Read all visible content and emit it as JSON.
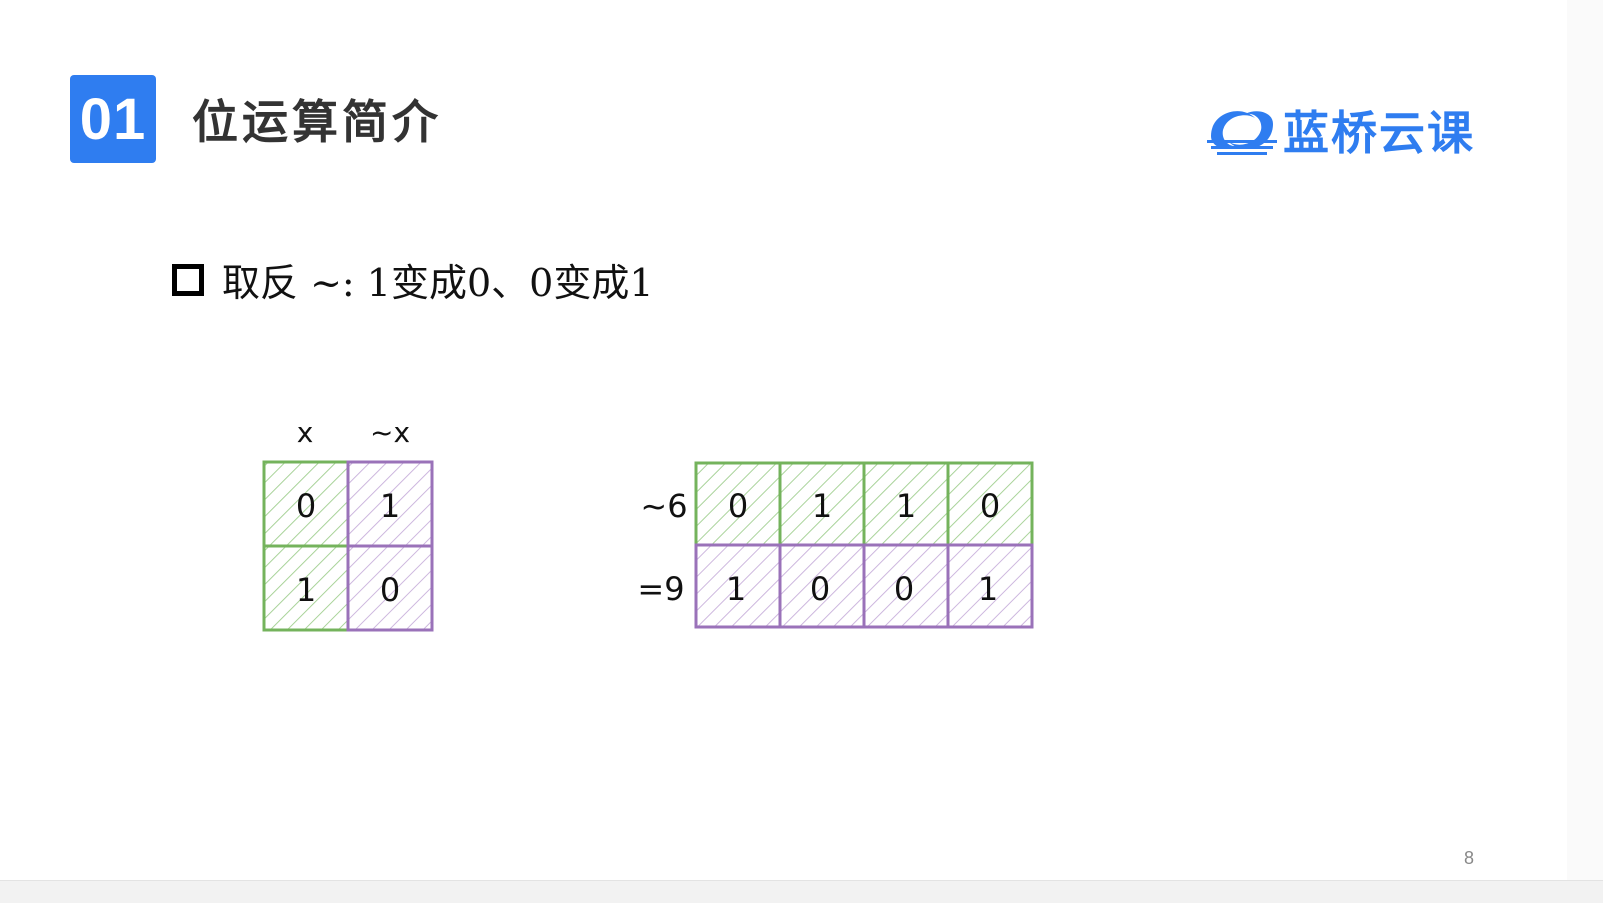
{
  "slide": {
    "section_number": "01",
    "title": "位运算简介",
    "brand_name": "蓝桥云课",
    "brand_icon": "lanqiao-logo-icon",
    "bullet_text": "取反 ~:  1变成0、0变成1",
    "page_number": "8"
  },
  "truth_table": {
    "headers": [
      "x",
      "~x"
    ],
    "rows": [
      [
        "0",
        "1"
      ],
      [
        "1",
        "0"
      ]
    ]
  },
  "example": {
    "row1_label": "~6",
    "row1_bits": [
      "0",
      "1",
      "1",
      "0"
    ],
    "row2_label": "=9",
    "row2_bits": [
      "1",
      "0",
      "0",
      "1"
    ]
  },
  "colors": {
    "accent": "#2f7df0",
    "green": "#74b35c",
    "purple": "#9a72b9"
  }
}
